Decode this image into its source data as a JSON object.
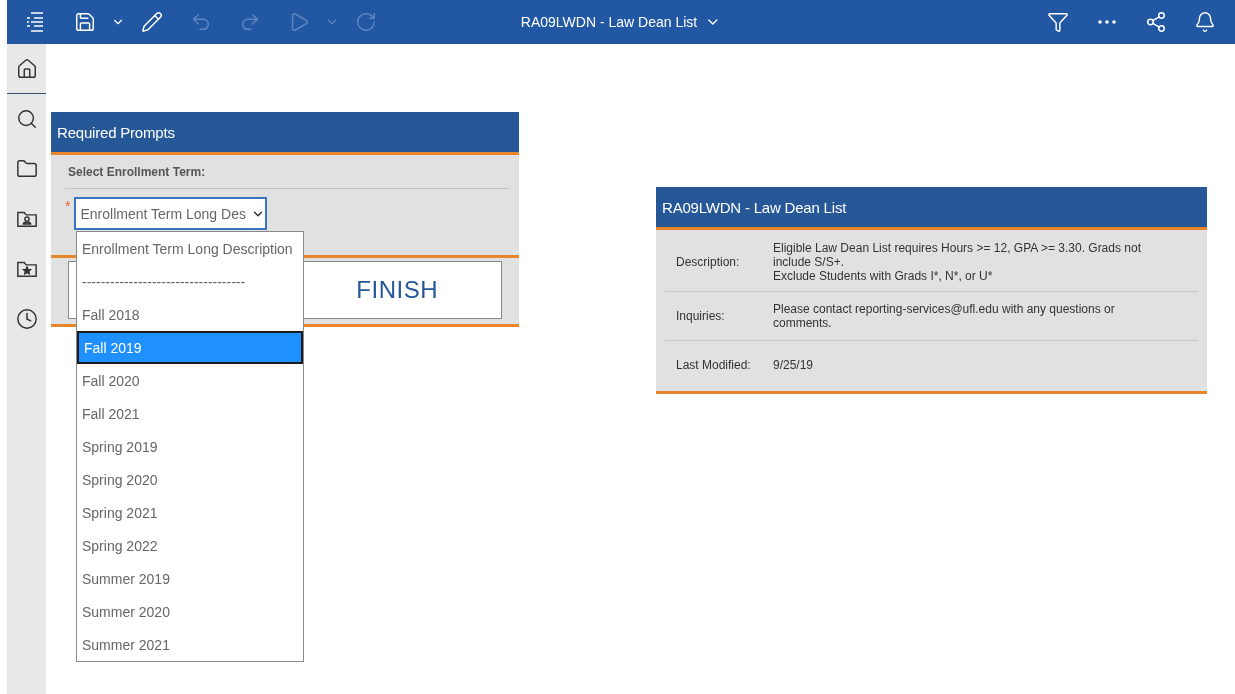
{
  "toolbar": {
    "left": [
      {
        "kind": "menu",
        "disabled": false
      },
      {
        "kind": "save",
        "disabled": false
      },
      {
        "kind": "caret",
        "disabled": false
      },
      {
        "kind": "edit",
        "disabled": false
      },
      {
        "kind": "undo",
        "disabled": true
      },
      {
        "kind": "redo",
        "disabled": true
      },
      {
        "kind": "run",
        "disabled": true
      },
      {
        "kind": "caret",
        "disabled": true
      },
      {
        "kind": "refresh",
        "disabled": true
      }
    ],
    "title": "RA09LWDN - Law Dean List",
    "right": [
      {
        "kind": "filter",
        "disabled": false
      },
      {
        "kind": "more",
        "disabled": false
      },
      {
        "kind": "share",
        "disabled": false
      },
      {
        "kind": "bell",
        "disabled": false
      }
    ]
  },
  "sidebar": {
    "items": [
      {
        "kind": "home"
      },
      {
        "kind": "search"
      },
      {
        "kind": "folder"
      },
      {
        "kind": "team-folder"
      },
      {
        "kind": "favorites"
      },
      {
        "kind": "recent"
      }
    ]
  },
  "prompts": {
    "title": "Required Prompts",
    "label": "Select Enrollment Term:",
    "required_mark": "*",
    "select_value": "Enrollment Term Long Des",
    "options": [
      {
        "label": "Enrollment Term Long Description",
        "selected": false
      },
      {
        "label": "-----------------------------------",
        "selected": false
      },
      {
        "label": "Fall 2018",
        "selected": false
      },
      {
        "label": "Fall 2019",
        "selected": true
      },
      {
        "label": "Fall 2020",
        "selected": false
      },
      {
        "label": "Fall 2021",
        "selected": false
      },
      {
        "label": "Spring 2019",
        "selected": false
      },
      {
        "label": "Spring 2020",
        "selected": false
      },
      {
        "label": "Spring 2021",
        "selected": false
      },
      {
        "label": "Spring 2022",
        "selected": false
      },
      {
        "label": "Summer 2019",
        "selected": false
      },
      {
        "label": "Summer 2020",
        "selected": false
      },
      {
        "label": "Summer 2021",
        "selected": false
      }
    ],
    "finish_button": "FINISH"
  },
  "info": {
    "title": "RA09LWDN - Law Dean List",
    "rows": [
      {
        "label": "Description:",
        "lines": [
          "Eligible Law Dean List requires Hours >= 12, GPA >= 3.30. Grads not include S/S+.",
          "Exclude Students with Grads I*, N*, or U*"
        ]
      },
      {
        "label": "Inquiries:",
        "lines": [
          "Please contact reporting-services@ufl.edu with any questions or comments."
        ]
      },
      {
        "label": "Last Modified:",
        "lines": [
          "9/25/19"
        ]
      }
    ]
  }
}
